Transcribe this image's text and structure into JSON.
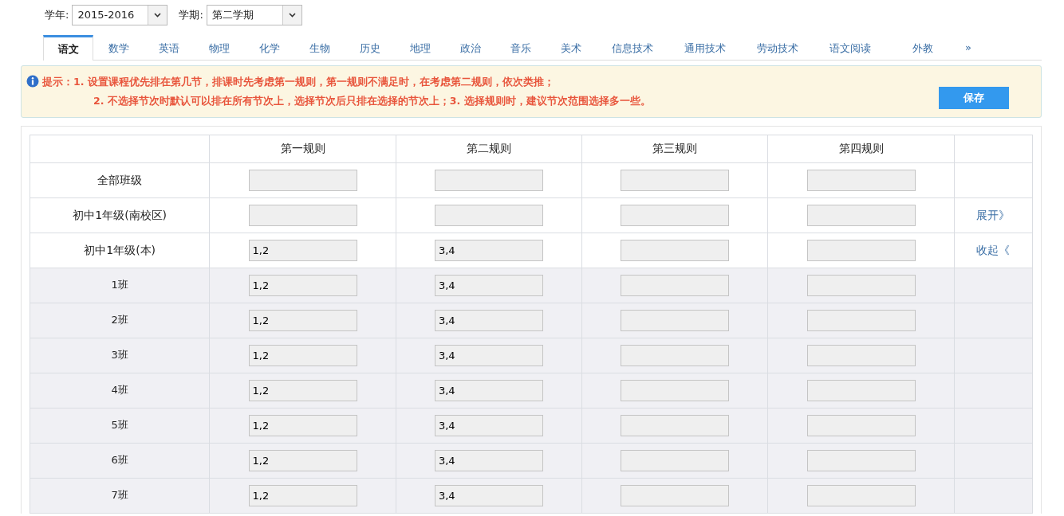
{
  "filters": [
    {
      "label": "学年:",
      "value": "2015-2016"
    },
    {
      "label": "学期:",
      "value": "第二学期"
    }
  ],
  "tabs": [
    {
      "label": "语文",
      "selected": true
    },
    {
      "label": "数学",
      "selected": false
    },
    {
      "label": "英语",
      "selected": false
    },
    {
      "label": "物理",
      "selected": false
    },
    {
      "label": "化学",
      "selected": false
    },
    {
      "label": "生物",
      "selected": false
    },
    {
      "label": "历史",
      "selected": false
    },
    {
      "label": "地理",
      "selected": false
    },
    {
      "label": "政治",
      "selected": false
    },
    {
      "label": "音乐",
      "selected": false
    },
    {
      "label": "美术",
      "selected": false
    },
    {
      "label": "信息技术",
      "selected": false
    },
    {
      "label": "通用技术",
      "selected": false
    },
    {
      "label": "劳动技术",
      "selected": false
    },
    {
      "label": "语文阅读",
      "selected": false
    },
    {
      "label": "外教",
      "selected": false
    }
  ],
  "tabs_more": "»",
  "notice": {
    "lines": [
      "提示：1. 设置课程优先排在第几节，排课时先考虑第一规则，第一规则不满足时，在考虑第二规则，依次类推；",
      "2. 不选择节次时默认可以排在所有节次上，选择节次后只排在选择的节次上；3. 选择规则时，建议节次范围选择多一些。"
    ],
    "button": "保存"
  },
  "table": {
    "columns": [
      "第一规则",
      "第二规则",
      "第三规则",
      "第四规则"
    ],
    "rows": [
      {
        "kind": "group",
        "label": "全部班级"
      },
      {
        "kind": "group",
        "label": "初中1年级(南校区)",
        "toggle": "展开》"
      },
      {
        "kind": "group",
        "label": "初中1年级(本)",
        "values": [
          "1,2",
          "3,4"
        ],
        "toggle": "收起《"
      },
      {
        "kind": "class",
        "label": "1班",
        "values": [
          "1,2",
          "3,4"
        ]
      },
      {
        "kind": "class",
        "label": "2班",
        "values": [
          "1,2",
          "3,4"
        ]
      },
      {
        "kind": "class",
        "label": "3班",
        "values": [
          "1,2",
          "3,4"
        ]
      },
      {
        "kind": "class",
        "label": "4班",
        "values": [
          "1,2",
          "3,4"
        ]
      },
      {
        "kind": "class",
        "label": "5班",
        "values": [
          "1,2",
          "3,4"
        ]
      },
      {
        "kind": "class",
        "label": "6班",
        "values": [
          "1,2",
          "3,4"
        ]
      },
      {
        "kind": "class",
        "label": "7班",
        "values": [
          "1,2",
          "3,4"
        ]
      }
    ]
  }
}
